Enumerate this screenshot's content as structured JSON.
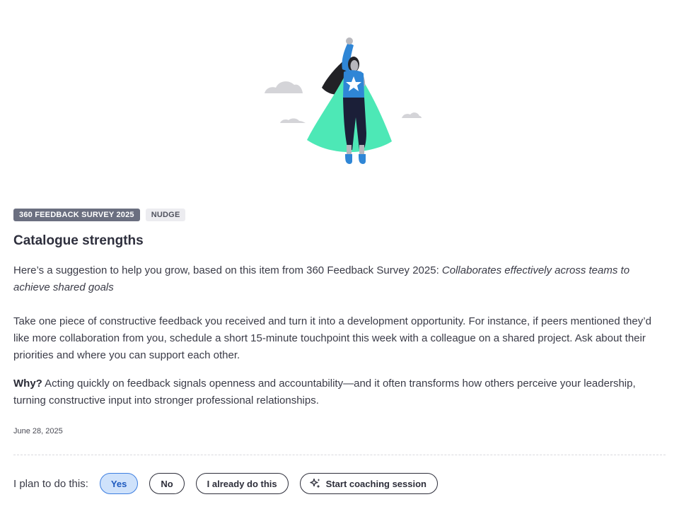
{
  "tags": {
    "survey": "360 FEEDBACK SURVEY 2025",
    "type": "NUDGE"
  },
  "card": {
    "title": "Catalogue strengths",
    "intro": "Here’s a suggestion to help you grow, based on this item from 360 Feedback Survey 2025: ",
    "intro_item": "Collaborates effectively across teams to achieve shared goals",
    "body": "Take one piece of constructive feedback you received and turn it into a development opportunity. For instance, if peers mentioned they’d like more collaboration from you, schedule a short 15-minute touchpoint this week with a colleague on a shared project. Ask about their priorities and where you can support each other.",
    "why_label": "Why?",
    "why_text": " Acting quickly on feedback signals openness and accountability—and it often transforms how others perceive your leadership, turning constructive input into stronger professional relationships.",
    "date": "June 28, 2025"
  },
  "plan": {
    "label": "I plan to do this:",
    "yes": "Yes",
    "no": "No",
    "already": "I already do this",
    "coaching": "Start coaching session",
    "selected": "Yes"
  },
  "colors": {
    "cape": "#4de8b6",
    "suit": "#2f86d6",
    "selected_fill": "#cfe2fb",
    "selected_border": "#3d7ee0"
  },
  "icons": {
    "coaching": "sparkle-icon",
    "hero": "superhero-illustration"
  }
}
